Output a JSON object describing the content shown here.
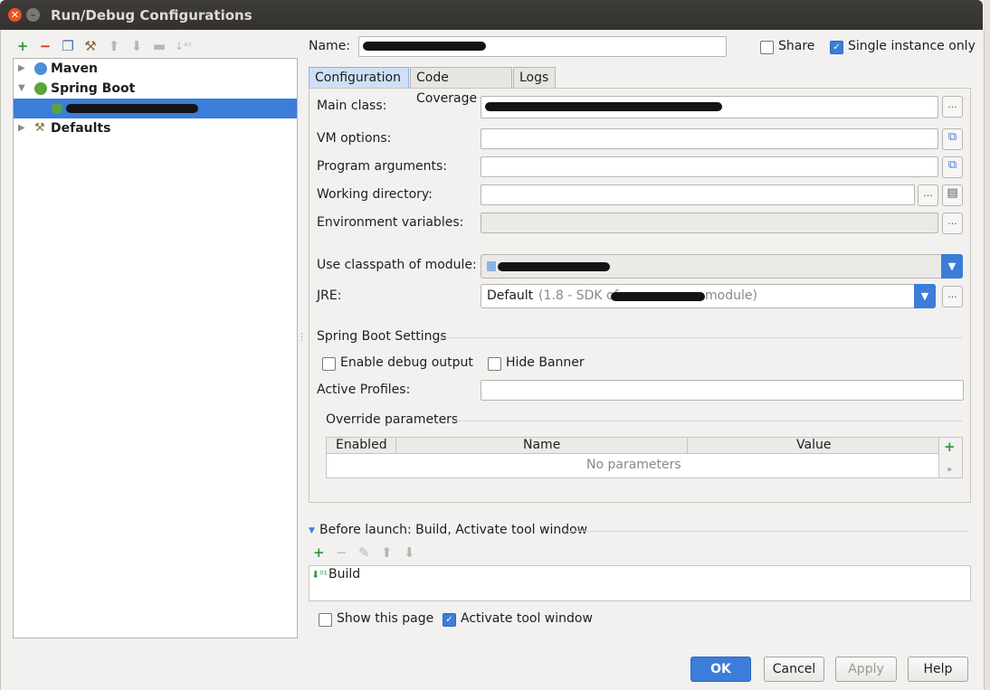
{
  "window": {
    "title": "Run/Debug Configurations"
  },
  "toolbar": {
    "icons": [
      "add-icon",
      "remove-icon",
      "copy-icon",
      "wrench-icon",
      "move-up-icon",
      "move-down-icon",
      "folder-icon",
      "sort-icon"
    ]
  },
  "tree": {
    "items": [
      {
        "label": "Maven"
      },
      {
        "label": "Spring Boot"
      },
      {
        "label": ""
      },
      {
        "label": "Defaults"
      }
    ]
  },
  "form": {
    "name_label": "Name:",
    "share_label": "Share",
    "single_instance_label": "Single instance only",
    "tabs": [
      {
        "label": "Configuration"
      },
      {
        "label": "Code Coverage"
      },
      {
        "label": "Logs"
      }
    ],
    "main_class_label": "Main class:",
    "vm_options_label": "VM options:",
    "program_args_label": "Program arguments:",
    "working_dir_label": "Working directory:",
    "env_vars_label": "Environment variables:",
    "classpath_label": "Use classpath of module:",
    "jre_label": "JRE:",
    "jre_value": "Default",
    "jre_hint_prefix": "(1.8 - SDK of",
    "jre_hint_suffix": "module)",
    "browse_glyph": "...",
    "spring_settings_title": "Spring Boot Settings",
    "debug_output_label": "Enable debug output",
    "hide_banner_label": "Hide Banner",
    "active_profiles_label": "Active Profiles:",
    "override_title": "Override parameters",
    "table": {
      "columns": [
        "Enabled",
        "Name",
        "Value"
      ],
      "empty_text": "No parameters"
    },
    "before_launch_title": "Before launch: Build, Activate tool window",
    "build_item": "Build",
    "show_page_label": "Show this page",
    "activate_tool_label": "Activate tool window"
  },
  "buttons": {
    "ok": "OK",
    "cancel": "Cancel",
    "apply": "Apply",
    "help": "Help"
  },
  "colors": {
    "accent": "#3b7dd8",
    "selection": "#3b7dd8",
    "titlebar": "#3c3b37",
    "close": "#e95420"
  }
}
